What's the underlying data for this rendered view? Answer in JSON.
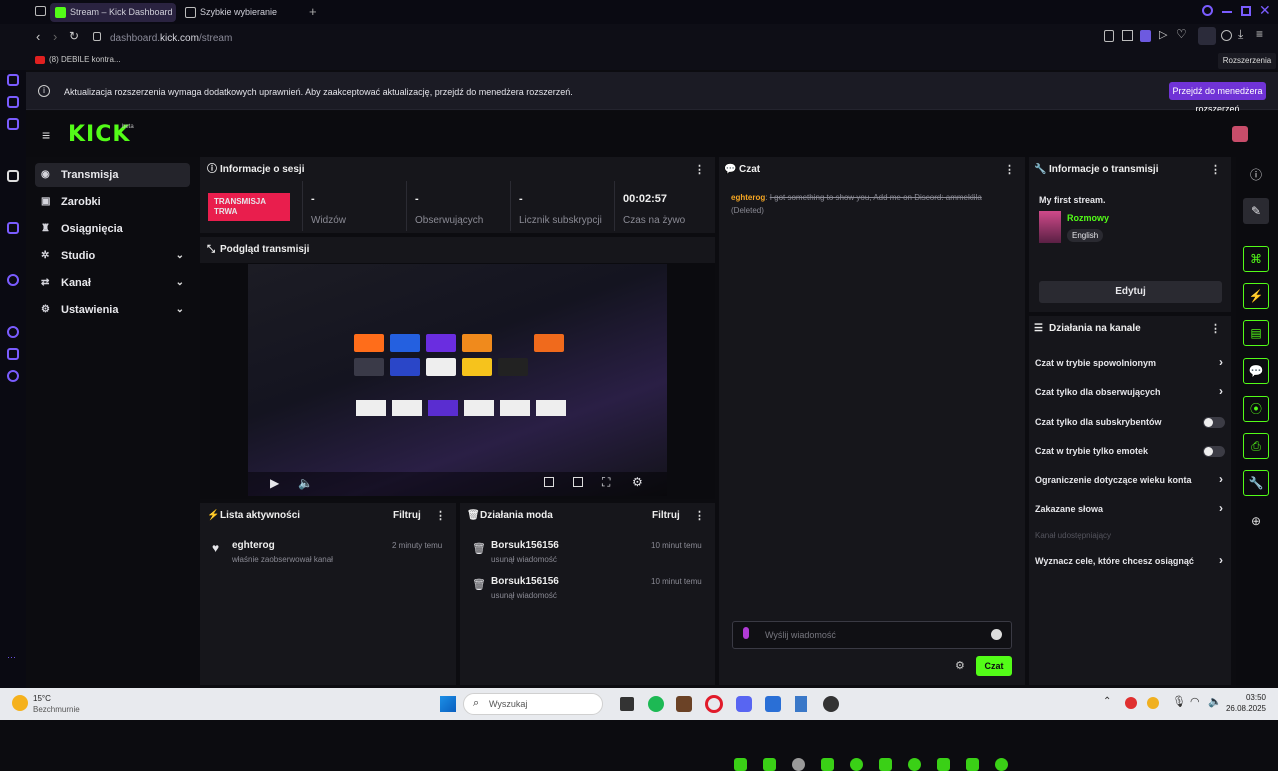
{
  "browser": {
    "tabs": [
      {
        "label": "Stream – Kick Dashboard"
      },
      {
        "label": "Szybkie wybieranie"
      }
    ],
    "url_prefix": "dashboard.",
    "url_domain": "kick.com",
    "url_path": "/stream",
    "bookmark": "(8) DEBILE kontra...",
    "tooltip": "Rozszerzenia"
  },
  "notification": {
    "text": "Aktualizacja rozszerzenia wymaga dodatkowych uprawnień. Aby zaakceptować aktualizację, przejdź do menedżera rozszerzeń.",
    "button": "Przejdź do menedżera rozszerzeń"
  },
  "kick": {
    "logo": "KICK",
    "beta": "beta"
  },
  "nav": [
    {
      "label": "Transmisja",
      "icon": "broadcast-icon"
    },
    {
      "label": "Zarobki",
      "icon": "wallet-icon"
    },
    {
      "label": "Osiągnięcia",
      "icon": "trophy-icon"
    },
    {
      "label": "Studio",
      "icon": "studio-icon"
    },
    {
      "label": "Kanał",
      "icon": "channel-icon"
    },
    {
      "label": "Ustawienia",
      "icon": "gear-icon"
    }
  ],
  "session": {
    "title": "Informacje o sesji",
    "live_badge": "TRANSMISJA TRWA",
    "stats": [
      {
        "value": "-",
        "label": "Widzów"
      },
      {
        "value": "-",
        "label": "Obserwujących"
      },
      {
        "value": "-",
        "label": "Licznik subskrypcji"
      },
      {
        "value": "00:02:57",
        "label": "Czas na żywo"
      }
    ]
  },
  "preview": {
    "title": "Podgląd transmisji"
  },
  "activity": {
    "title": "Lista aktywności",
    "filter": "Filtruj",
    "items": [
      {
        "user": "eghterog",
        "text": "właśnie zaobserwował kanał",
        "time": "2 minuty temu"
      }
    ]
  },
  "modactions": {
    "title": "Działania moda",
    "filter": "Filtruj",
    "items": [
      {
        "user": "Borsuk156156",
        "text": "usunął wiadomość",
        "time": "10 minut temu"
      },
      {
        "user": "Borsuk156156",
        "text": "usunął wiadomość",
        "time": "10 minut temu"
      }
    ]
  },
  "chat": {
    "title": "Czat",
    "message_user": "eghterog",
    "message_text": "I got something to show you, Add me on Discord: ammeklila",
    "message_status": "(Deleted)",
    "input_placeholder": "Wyślij wiadomość",
    "send": "Czat"
  },
  "streaminfo": {
    "title": "Informacje o transmisji",
    "stream_title": "My first stream.",
    "category": "Rozmowy",
    "language": "English",
    "edit": "Edytuj"
  },
  "channel_actions": {
    "title": "Działania na kanale",
    "items": [
      {
        "label": "Czat w trybie spowolnionym",
        "control": "chevron"
      },
      {
        "label": "Czat tylko dla obserwujących",
        "control": "chevron"
      },
      {
        "label": "Czat tylko dla subskrybentów",
        "control": "toggle"
      },
      {
        "label": "Czat w trybie tylko emotek",
        "control": "toggle"
      },
      {
        "label": "Ograniczenie dotyczące wieku konta",
        "control": "chevron"
      },
      {
        "label": "Zakazane słowa",
        "control": "chevron"
      },
      {
        "label": "Kanał udostępniający",
        "control": "none"
      },
      {
        "label": "Wyznacz cele, które chcesz osiągnąć",
        "control": "chevron"
      }
    ]
  },
  "taskbar": {
    "weather_temp": "15°C",
    "weather_desc": "Bezchmurnie",
    "search": "Wyszukaj",
    "time": "03:50",
    "date": "26.08.2025"
  },
  "colors": {
    "kick_green": "#53fc18",
    "live_red": "#e91e4d",
    "accent_purple": "#7033d6"
  }
}
